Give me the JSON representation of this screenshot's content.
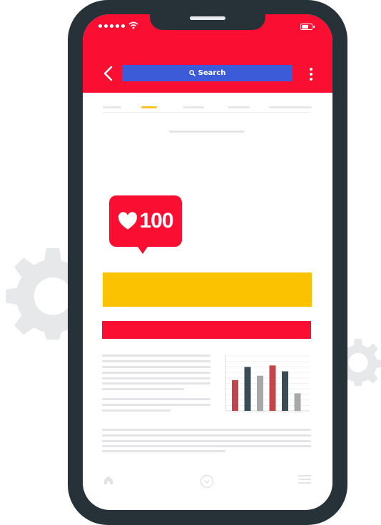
{
  "header": {
    "search_label": "Search"
  },
  "icons": {
    "back": "chevron-left-icon",
    "search": "search-icon",
    "more": "more-vertical-icon",
    "like": "heart-icon",
    "home": "home-icon",
    "center": "chevron-down-circle-icon",
    "menu": "hamburger-menu-icon"
  },
  "like_badge": {
    "count": "100"
  },
  "colors": {
    "app_bar": "#fa0e31",
    "search_bar": "#3b5bd9",
    "highlight": "#fbc201",
    "phone_body": "#263238",
    "chart_red": "#c1454a",
    "chart_dark": "#3a4d56",
    "chart_gray": "#a8a8a8"
  },
  "tabs": [
    {
      "active": false
    },
    {
      "active": true
    },
    {
      "active": false
    },
    {
      "active": false
    },
    {
      "active": false
    }
  ],
  "chart_data": {
    "type": "bar",
    "values": [
      42,
      60,
      48,
      62,
      54,
      24
    ],
    "colors": [
      "#c1454a",
      "#3a4d56",
      "#a8a8a8",
      "#c1454a",
      "#3a4d56",
      "#a8a8a8"
    ],
    "ylim": [
      0,
      75
    ],
    "grid": true
  }
}
